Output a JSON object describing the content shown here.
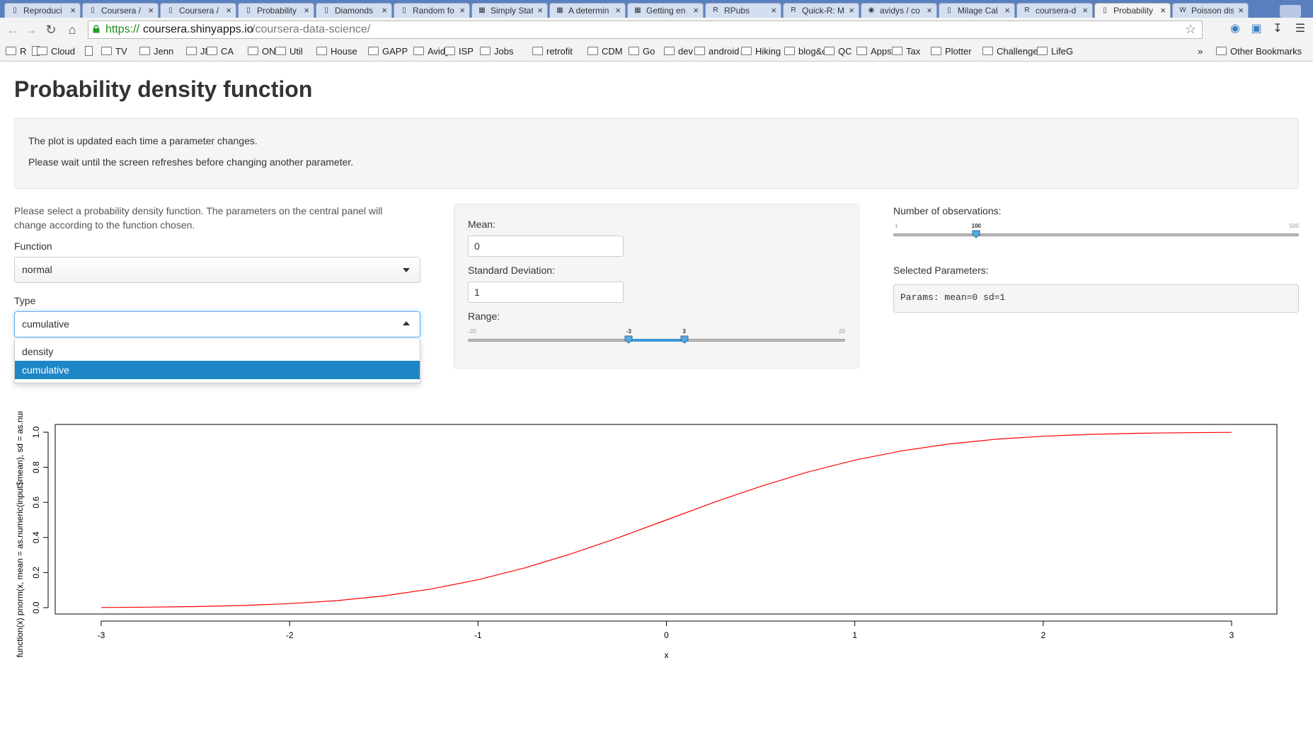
{
  "browser": {
    "tabs": [
      {
        "title": "Reproduci",
        "icon": "page-icon"
      },
      {
        "title": "Coursera /",
        "icon": "page-icon"
      },
      {
        "title": "Coursera /",
        "icon": "page-icon"
      },
      {
        "title": "Probability",
        "icon": "page-icon"
      },
      {
        "title": "Diamonds",
        "icon": "page-icon"
      },
      {
        "title": "Random fo",
        "icon": "page-icon"
      },
      {
        "title": "Simply Stat",
        "icon": "grid-icon"
      },
      {
        "title": "A determin",
        "icon": "grid-icon"
      },
      {
        "title": "Getting en",
        "icon": "grid-icon"
      },
      {
        "title": "RPubs",
        "icon": "rpubs-icon"
      },
      {
        "title": "Quick-R: M",
        "icon": "r-icon"
      },
      {
        "title": "avidys / co",
        "icon": "github-icon"
      },
      {
        "title": "Milage Cal",
        "icon": "page-icon"
      },
      {
        "title": "coursera-d",
        "icon": "rstudio-icon"
      },
      {
        "title": "Probability",
        "icon": "page-icon"
      },
      {
        "title": "Poisson dis",
        "icon": "wikipedia-icon"
      }
    ],
    "url": {
      "scheme": "https://",
      "host": "coursera.shinyapps.io",
      "path": "/coursera-data-science/"
    },
    "bookmarks": [
      "R",
      "",
      "Cloud",
      "",
      "TV",
      "Jenn",
      "JM",
      "CA",
      "ON",
      "Util",
      "House",
      "GAPP",
      "Avidys",
      "ISP",
      "Jobs",
      "retrofit",
      "CDM",
      "Go",
      "dev",
      "android",
      "Hiking",
      "blog&co",
      "QC",
      "Apps",
      "Tax",
      "Plotter",
      "Challenge",
      "LifeG"
    ],
    "bookmarks_overflow": "»",
    "other_bookmarks": "Other Bookmarks"
  },
  "page": {
    "title": "Probability density function",
    "info_lines": [
      "The plot is updated each time a parameter changes.",
      "Please wait until the screen refreshes before changing another parameter."
    ],
    "help_text": "Please select a probability density function. The parameters on the central panel will change according to the function chosen.",
    "function_label": "Function",
    "function_value": "normal",
    "type_label": "Type",
    "type_value": "cumulative",
    "type_options": [
      "density",
      "cumulative"
    ],
    "mean_label": "Mean:",
    "mean_value": "0",
    "sd_label": "Standard Deviation:",
    "sd_value": "1",
    "range_label": "Range:",
    "range": {
      "min": "-20",
      "max": "20",
      "low": "-3",
      "high": "3",
      "min_value": -20,
      "max_value": 20,
      "low_value": -3,
      "high_value": 3
    },
    "obs_label": "Number of observations:",
    "obs": {
      "min": "1",
      "max": "500",
      "value": "100",
      "min_value": 1,
      "max_value": 500,
      "current": 100
    },
    "selected_params_label": "Selected Parameters:",
    "selected_params": "Params: mean=0 sd=1"
  },
  "colors": {
    "curve": "#ff0000",
    "selected_option": "#1f86c6",
    "slider_fill": "#3a98d8"
  },
  "chart_data": {
    "type": "line",
    "title": "",
    "xlabel": "x",
    "ylabel": "function(x) pnorm(x, mean = as.numeric(input$mean), sd = as.numeric(input",
    "xlim": [
      -3,
      3
    ],
    "ylim": [
      0,
      1
    ],
    "x_ticks": [
      "-3",
      "-2",
      "-1",
      "0",
      "1",
      "2",
      "3"
    ],
    "y_ticks": [
      "0.0",
      "0.2",
      "0.4",
      "0.6",
      "0.8",
      "1.0"
    ],
    "series": [
      {
        "x": [
          -3,
          -2.75,
          -2.5,
          -2.25,
          -2,
          -1.75,
          -1.5,
          -1.25,
          -1,
          -0.75,
          -0.5,
          -0.25,
          0,
          0.25,
          0.5,
          0.75,
          1,
          1.25,
          1.5,
          1.75,
          2,
          2.25,
          2.5,
          2.75,
          3
        ],
        "values": [
          0.001,
          0.003,
          0.006,
          0.012,
          0.023,
          0.04,
          0.067,
          0.106,
          0.159,
          0.227,
          0.309,
          0.401,
          0.5,
          0.599,
          0.691,
          0.773,
          0.841,
          0.894,
          0.933,
          0.96,
          0.977,
          0.988,
          0.994,
          0.997,
          0.999
        ]
      }
    ]
  }
}
